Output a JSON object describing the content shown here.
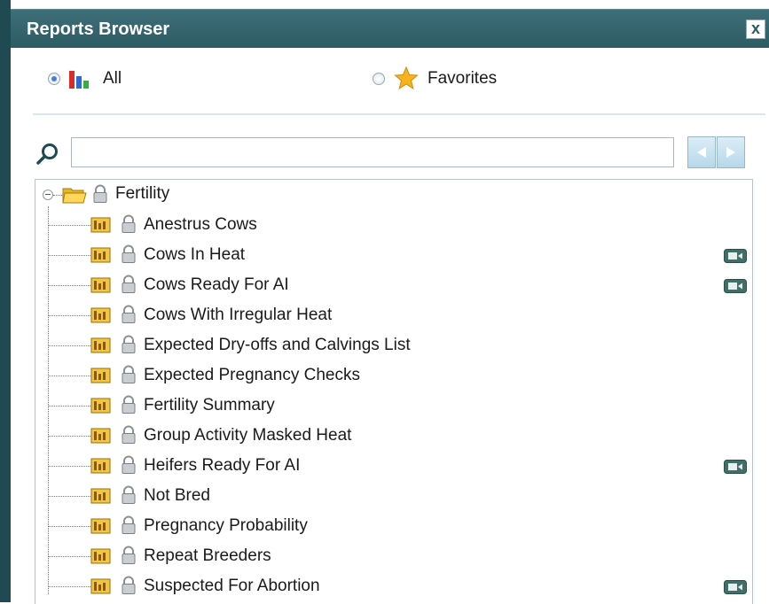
{
  "window": {
    "title": "Reports Browser",
    "close_glyph": "x"
  },
  "filter": {
    "options": [
      {
        "label": "All",
        "selected": true,
        "icon": "bar-chart-icon"
      },
      {
        "label": "Favorites",
        "selected": false,
        "icon": "star-icon"
      }
    ]
  },
  "search": {
    "value": "",
    "placeholder": ""
  },
  "tree": {
    "root": {
      "label": "Fertility",
      "expanded": true,
      "icon": "folder-open-icon",
      "locked": true
    },
    "items": [
      {
        "label": "Anestrus Cows",
        "badge": false
      },
      {
        "label": "Cows In Heat",
        "badge": true
      },
      {
        "label": "Cows Ready For AI",
        "badge": true
      },
      {
        "label": "Cows With Irregular Heat",
        "badge": false
      },
      {
        "label": "Expected Dry-offs and Calvings List",
        "badge": false
      },
      {
        "label": "Expected Pregnancy Checks",
        "badge": false
      },
      {
        "label": "Fertility Summary",
        "badge": false
      },
      {
        "label": "Group Activity Masked Heat",
        "badge": false
      },
      {
        "label": "Heifers Ready For AI",
        "badge": true
      },
      {
        "label": "Not Bred",
        "badge": false
      },
      {
        "label": "Pregnancy Probability",
        "badge": false
      },
      {
        "label": "Repeat Breeders",
        "badge": false
      },
      {
        "label": "Suspected For Abortion",
        "badge": true
      }
    ]
  },
  "colors": {
    "titlebar": "#2c5a63",
    "accent": "#4a7fd0",
    "nav_button": "#b6d8ea",
    "tree_border": "#b7c3ca"
  }
}
